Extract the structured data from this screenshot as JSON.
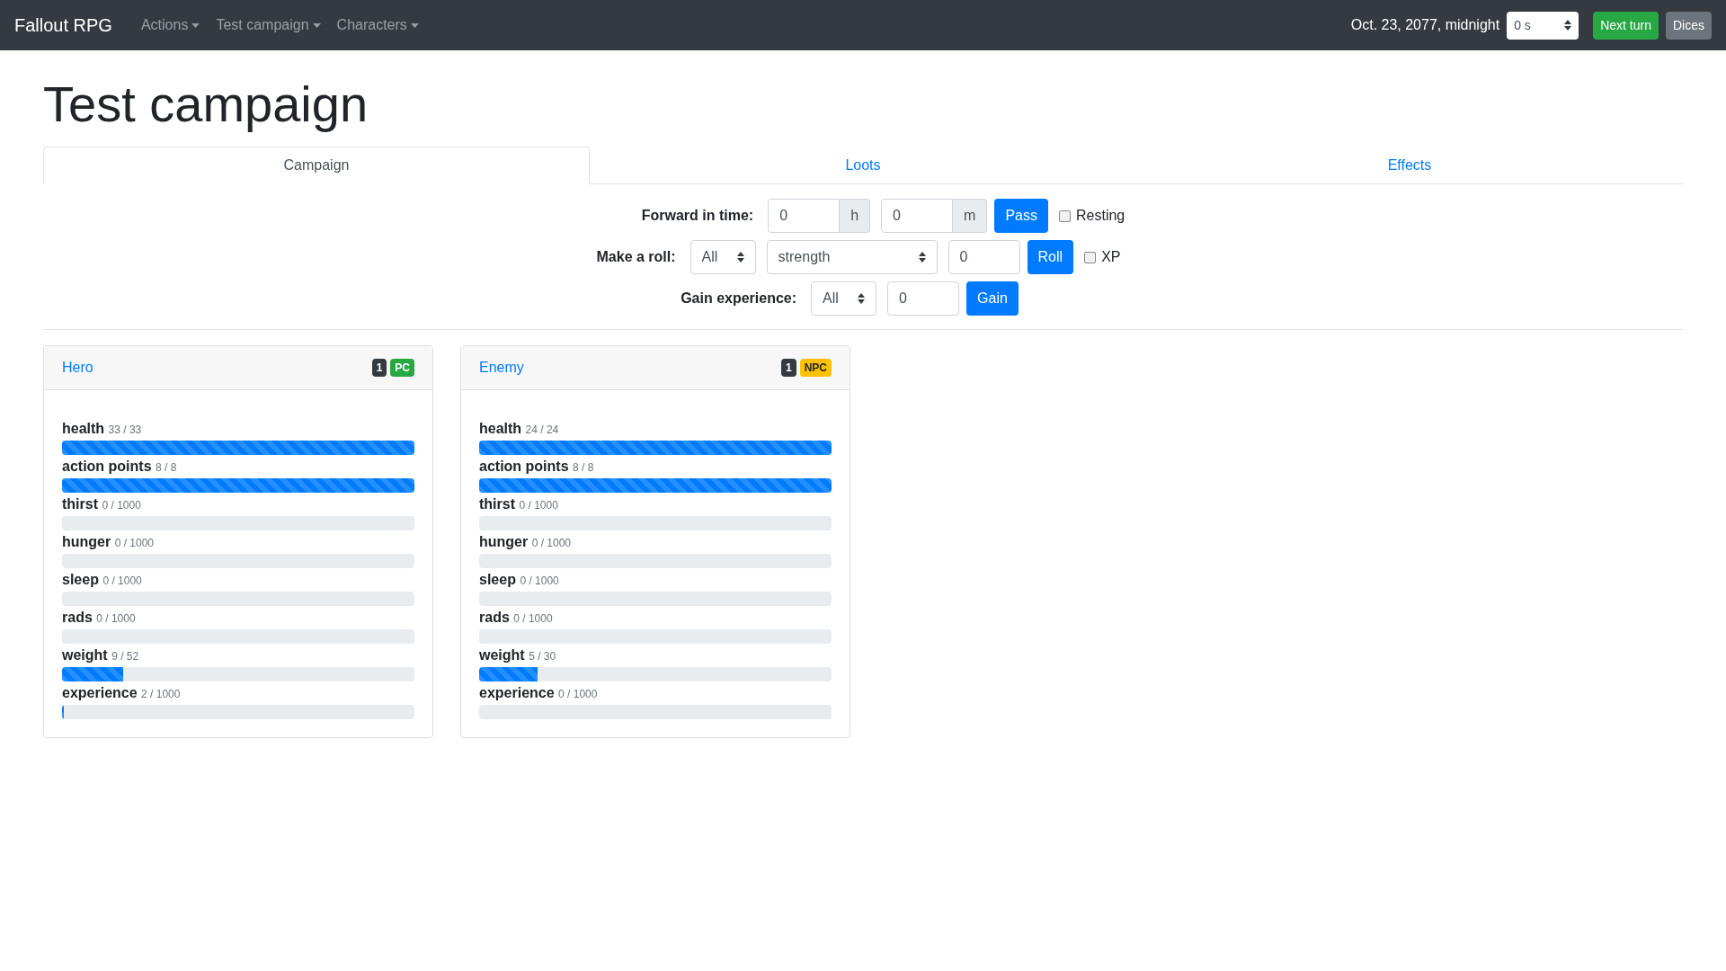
{
  "navbar": {
    "brand": "Fallout RPG",
    "menus": [
      {
        "label": "Actions"
      },
      {
        "label": "Test campaign"
      },
      {
        "label": "Characters"
      }
    ],
    "date": "Oct. 23, 2077, midnight",
    "duration_select": {
      "value": "0 s"
    },
    "buttons": [
      {
        "label": "Next turn",
        "kind": "success"
      },
      {
        "label": "Dices",
        "kind": "secondary"
      }
    ]
  },
  "page_title": "Test campaign",
  "tabs": [
    {
      "label": "Campaign",
      "selected": true
    },
    {
      "label": "Loots",
      "selected": false
    },
    {
      "label": "Effects",
      "selected": false
    }
  ],
  "forms": {
    "forward": {
      "label": "Forward in time:",
      "hours": {
        "value": "0",
        "unit": "h"
      },
      "minutes": {
        "value": "0",
        "unit": "m"
      },
      "button": "Pass",
      "checkbox": {
        "label": "Resting",
        "checked": false
      }
    },
    "roll": {
      "label": "Make a roll:",
      "target": "All",
      "stat": "strength",
      "value": "0",
      "button": "Roll",
      "checkbox": {
        "label": "XP",
        "checked": false
      }
    },
    "experience": {
      "label": "Gain experience:",
      "target": "All",
      "value": "0",
      "button": "Gain"
    }
  },
  "characters": [
    {
      "name": "Hero",
      "count": "1",
      "type": {
        "label": "PC",
        "color": "#28a745"
      },
      "stats": [
        {
          "name": "health",
          "reading": "33 / 33",
          "level": 1
        },
        {
          "name": "action points",
          "reading": "8 / 8",
          "level": 1
        },
        {
          "name": "thirst",
          "reading": "0 / 1000",
          "level": 0
        },
        {
          "name": "hunger",
          "reading": "0 / 1000",
          "level": 0
        },
        {
          "name": "sleep",
          "reading": "0 / 1000",
          "level": 0
        },
        {
          "name": "rads",
          "reading": "0 / 1000",
          "level": 0
        },
        {
          "name": "weight",
          "reading": "9 / 52",
          "level": 0.173
        },
        {
          "name": "experience",
          "reading": "2 / 1000",
          "level": 0.002
        }
      ]
    },
    {
      "name": "Enemy",
      "count": "1",
      "type": {
        "label": "NPC",
        "color": "#ffc107"
      },
      "stats": [
        {
          "name": "health",
          "reading": "24 / 24",
          "level": 1
        },
        {
          "name": "action points",
          "reading": "8 / 8",
          "level": 1
        },
        {
          "name": "thirst",
          "reading": "0 / 1000",
          "level": 0
        },
        {
          "name": "hunger",
          "reading": "0 / 1000",
          "level": 0
        },
        {
          "name": "sleep",
          "reading": "0 / 1000",
          "level": 0
        },
        {
          "name": "rads",
          "reading": "0 / 1000",
          "level": 0
        },
        {
          "name": "weight",
          "reading": "5 / 30",
          "level": 0.167
        },
        {
          "name": "experience",
          "reading": "0 / 1000",
          "level": 0
        }
      ]
    }
  ]
}
